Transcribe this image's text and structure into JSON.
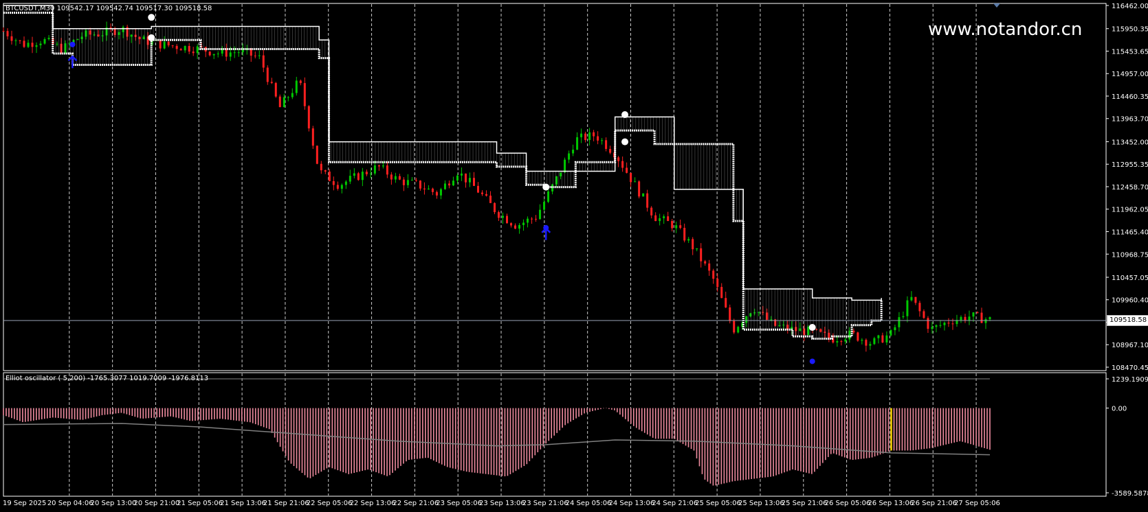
{
  "header": {
    "symbol_text": "BTCUSDT,M30",
    "ohlc_text": "109542.17 109542.74 109517.30 109518.58"
  },
  "watermark": "www.notandor.cn",
  "current_price_label": "109518.58",
  "indicator": {
    "label": "Elliot oscillator ( 5,200)",
    "values_text": "-1765.3077 1019.7009 -1976.8113",
    "axis_labels": [
      "1239.1909",
      "0.00",
      "-3589.5878"
    ]
  },
  "colors": {
    "background": "#000000",
    "bull": "#00c800",
    "bear": "#ff2020",
    "band": "#ffffff",
    "signal": "#1a1aff",
    "histogram": "#f08ca0",
    "highlight_bar": "#ffd400",
    "oscillator_line": "#808080",
    "grid": "#ffffff"
  },
  "chart_data": [
    {
      "type": "candlestick",
      "panel": "price",
      "y_axis_labels": [
        "116462.00",
        "115950.35",
        "115453.65",
        "114957.00",
        "114460.35",
        "113963.70",
        "113452.00",
        "112955.35",
        "112458.70",
        "111962.05",
        "111465.40",
        "110968.75",
        "110457.05",
        "109960.40",
        "109463.75",
        "108967.10",
        "108470.45"
      ],
      "ylim": [
        108470.45,
        116462.0
      ],
      "x_axis_labels": [
        "19 Sep 2025",
        "20 Sep 04:06",
        "20 Sep 13:00",
        "20 Sep 21:00",
        "21 Sep 05:06",
        "21 Sep 13:06",
        "21 Sep 21:06",
        "22 Sep 05:06",
        "22 Sep 13:06",
        "22 Sep 21:06",
        "23 Sep 05:06",
        "23 Sep 13:06",
        "23 Sep 21:06",
        "24 Sep 05:06",
        "24 Sep 13:06",
        "24 Sep 21:06",
        "25 Sep 05:06",
        "25 Sep 13:06",
        "25 Sep 21:06",
        "26 Sep 05:06",
        "26 Sep 13:06",
        "26 Sep 21:06",
        "27 Sep 05:06"
      ],
      "close_path": [
        [
          0,
          115900
        ],
        [
          0.02,
          115600
        ],
        [
          0.04,
          115700
        ],
        [
          0.06,
          115500
        ],
        [
          0.08,
          115800
        ],
        [
          0.1,
          115850
        ],
        [
          0.12,
          115950
        ],
        [
          0.14,
          115700
        ],
        [
          0.16,
          115600
        ],
        [
          0.18,
          115550
        ],
        [
          0.2,
          115500
        ],
        [
          0.22,
          115400
        ],
        [
          0.24,
          115450
        ],
        [
          0.26,
          115300
        ],
        [
          0.28,
          114200
        ],
        [
          0.3,
          114800
        ],
        [
          0.32,
          112800
        ],
        [
          0.34,
          112500
        ],
        [
          0.36,
          112700
        ],
        [
          0.38,
          112900
        ],
        [
          0.4,
          112600
        ],
        [
          0.42,
          112500
        ],
        [
          0.44,
          112300
        ],
        [
          0.46,
          112800
        ],
        [
          0.48,
          112400
        ],
        [
          0.5,
          111900
        ],
        [
          0.52,
          111600
        ],
        [
          0.54,
          111800
        ],
        [
          0.56,
          112600
        ],
        [
          0.58,
          113500
        ],
        [
          0.6,
          113600
        ],
        [
          0.62,
          113200
        ],
        [
          0.64,
          112500
        ],
        [
          0.66,
          111800
        ],
        [
          0.68,
          111600
        ],
        [
          0.7,
          111100
        ],
        [
          0.72,
          110400
        ],
        [
          0.74,
          109300
        ],
        [
          0.76,
          109800
        ],
        [
          0.78,
          109400
        ],
        [
          0.8,
          109300
        ],
        [
          0.82,
          109250
        ],
        [
          0.84,
          109100
        ],
        [
          0.86,
          109200
        ],
        [
          0.88,
          109000
        ],
        [
          0.9,
          109200
        ],
        [
          0.92,
          110000
        ],
        [
          0.94,
          109300
        ],
        [
          0.96,
          109500
        ],
        [
          0.98,
          109600
        ],
        [
          1,
          109520
        ]
      ],
      "upper_band": [
        [
          0,
          116462
        ],
        [
          0.05,
          115950
        ],
        [
          0.15,
          116000
        ],
        [
          0.32,
          115700
        ],
        [
          0.33,
          113450
        ],
        [
          0.5,
          113200
        ],
        [
          0.53,
          112800
        ],
        [
          0.62,
          114000
        ],
        [
          0.66,
          114000
        ],
        [
          0.68,
          112400
        ],
        [
          0.74,
          112400
        ],
        [
          0.75,
          110200
        ],
        [
          0.82,
          110000
        ],
        [
          0.84,
          110000
        ],
        [
          0.86,
          109950
        ],
        [
          0.89,
          110000
        ]
      ],
      "lower_band": [
        [
          0,
          116300
        ],
        [
          0.05,
          115400
        ],
        [
          0.07,
          115150
        ],
        [
          0.15,
          115700
        ],
        [
          0.2,
          115500
        ],
        [
          0.26,
          115500
        ],
        [
          0.32,
          115300
        ],
        [
          0.33,
          113000
        ],
        [
          0.5,
          112900
        ],
        [
          0.53,
          112500
        ],
        [
          0.55,
          112450
        ],
        [
          0.58,
          113000
        ],
        [
          0.62,
          113700
        ],
        [
          0.66,
          113400
        ],
        [
          0.68,
          113400
        ],
        [
          0.74,
          111700
        ],
        [
          0.75,
          109300
        ],
        [
          0.8,
          109150
        ],
        [
          0.82,
          109100
        ],
        [
          0.84,
          109150
        ],
        [
          0.86,
          109400
        ],
        [
          0.88,
          109500
        ],
        [
          0.89,
          109950
        ]
      ],
      "signal_arrows": [
        {
          "position": 0.07,
          "price": 115200,
          "direction": "up"
        },
        {
          "position": 0.55,
          "price": 111400,
          "direction": "up"
        }
      ],
      "signal_dots": [
        {
          "position": 0.07,
          "price": 115600,
          "color": "blue"
        },
        {
          "position": 0.15,
          "price": 116200,
          "color": "white"
        },
        {
          "position": 0.15,
          "price": 115750,
          "color": "white"
        },
        {
          "position": 0.55,
          "price": 111550,
          "color": "blue"
        },
        {
          "position": 0.55,
          "price": 112450,
          "color": "white"
        },
        {
          "position": 0.63,
          "price": 114050,
          "color": "white"
        },
        {
          "position": 0.63,
          "price": 113450,
          "color": "white"
        },
        {
          "position": 0.82,
          "price": 108600,
          "color": "blue"
        },
        {
          "position": 0.82,
          "price": 109350,
          "color": "white"
        }
      ],
      "current_price": 109518.58
    },
    {
      "type": "bar",
      "panel": "oscillator",
      "series_name": "Elliot oscillator ( 5,200)",
      "ylim": [
        -3589.5878,
        1239.1909
      ],
      "histogram_path": [
        [
          0,
          -300
        ],
        [
          0.02,
          -600
        ],
        [
          0.05,
          -400
        ],
        [
          0.08,
          -500
        ],
        [
          0.1,
          -300
        ],
        [
          0.12,
          -200
        ],
        [
          0.14,
          -450
        ],
        [
          0.17,
          -350
        ],
        [
          0.19,
          -550
        ],
        [
          0.22,
          -450
        ],
        [
          0.25,
          -600
        ],
        [
          0.27,
          -900
        ],
        [
          0.29,
          -2300
        ],
        [
          0.31,
          -3000
        ],
        [
          0.33,
          -2500
        ],
        [
          0.35,
          -2800
        ],
        [
          0.37,
          -2600
        ],
        [
          0.39,
          -2900
        ],
        [
          0.41,
          -2200
        ],
        [
          0.43,
          -2100
        ],
        [
          0.45,
          -2500
        ],
        [
          0.47,
          -2700
        ],
        [
          0.49,
          -2800
        ],
        [
          0.51,
          -2900
        ],
        [
          0.53,
          -2400
        ],
        [
          0.55,
          -1500
        ],
        [
          0.57,
          -700
        ],
        [
          0.59,
          -200
        ],
        [
          0.61,
          0
        ],
        [
          0.62,
          -100
        ],
        [
          0.64,
          -800
        ],
        [
          0.66,
          -1300
        ],
        [
          0.68,
          -1300
        ],
        [
          0.7,
          -1800
        ],
        [
          0.71,
          -3000
        ],
        [
          0.72,
          -3300
        ],
        [
          0.74,
          -3100
        ],
        [
          0.76,
          -3000
        ],
        [
          0.78,
          -2900
        ],
        [
          0.8,
          -2600
        ],
        [
          0.82,
          -2800
        ],
        [
          0.84,
          -1900
        ],
        [
          0.86,
          -2200
        ],
        [
          0.88,
          -2100
        ],
        [
          0.9,
          -1800
        ],
        [
          0.92,
          -1800
        ],
        [
          0.94,
          -1700
        ],
        [
          0.97,
          -1400
        ],
        [
          1,
          -1765
        ]
      ],
      "line_path": [
        [
          0,
          -700
        ],
        [
          0.12,
          -650
        ],
        [
          0.2,
          -800
        ],
        [
          0.3,
          -1100
        ],
        [
          0.4,
          -1400
        ],
        [
          0.5,
          -1600
        ],
        [
          0.55,
          -1550
        ],
        [
          0.62,
          -1350
        ],
        [
          0.7,
          -1400
        ],
        [
          0.8,
          -1600
        ],
        [
          0.9,
          -1900
        ],
        [
          1,
          -1977
        ]
      ],
      "highlighted_position": 0.9
    }
  ]
}
